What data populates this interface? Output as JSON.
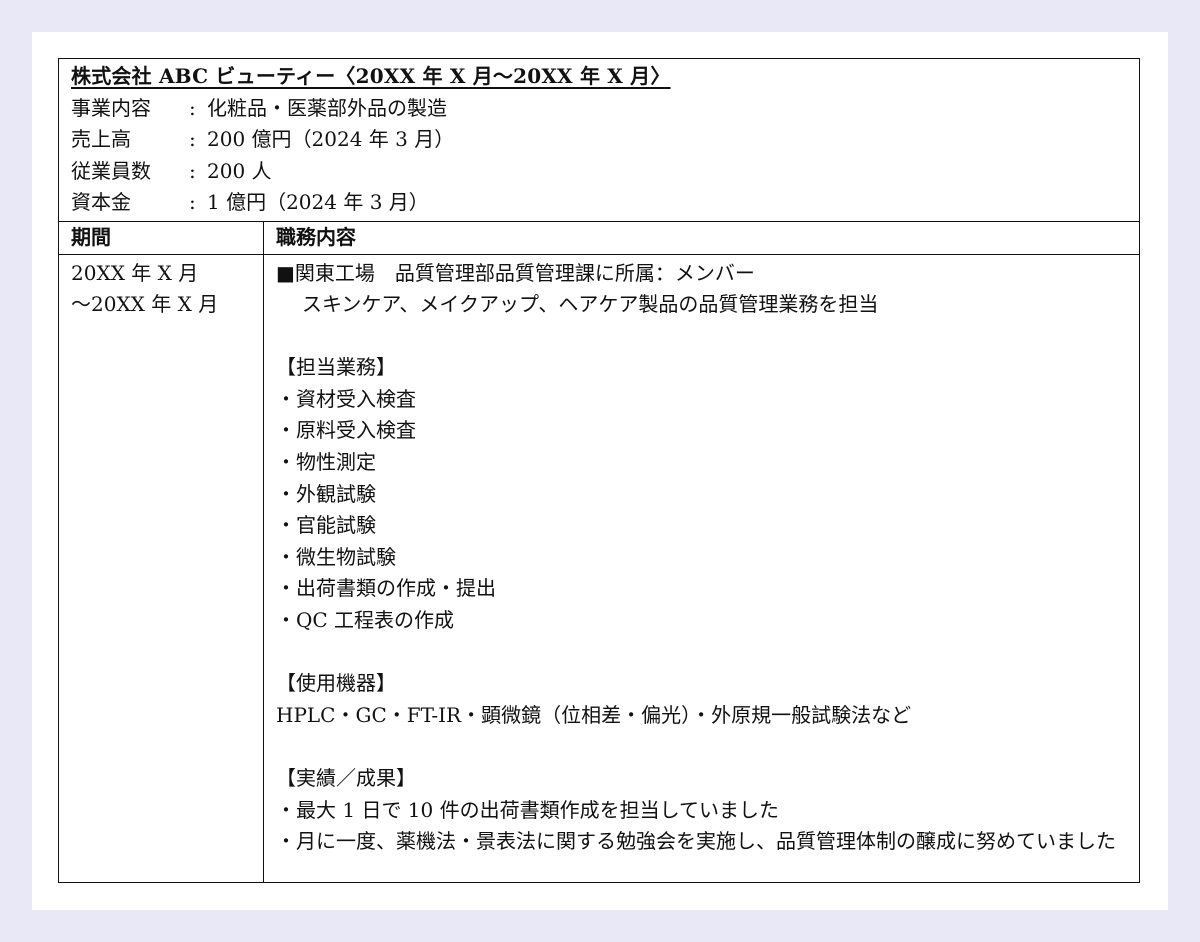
{
  "company": {
    "name": "株式会社 ABC ビューティー〈20XX 年 X 月〜20XX 年 X 月〉",
    "info": [
      {
        "label": "事業内容",
        "value": "化粧品・医薬部外品の製造"
      },
      {
        "label": "売上高",
        "value": "200 億円（2024 年 3 月）"
      },
      {
        "label": "従業員数",
        "value": "200 人"
      },
      {
        "label": "資本金",
        "value": "1 億円（2024 年 3 月）"
      }
    ],
    "separator": ":"
  },
  "table": {
    "header_period": "期間",
    "header_duties": "職務内容",
    "period_line1": "20XX 年 X 月",
    "period_line2": "〜20XX 年 X 月",
    "duty_title": "■関東工場　品質管理部品質管理課に所属：メンバー",
    "duty_summary": "スキンケア、メイクアップ、ヘアケア製品の品質管理業務を担当",
    "section_tasks": "【担当業務】",
    "tasks": [
      "・資材受入検査",
      "・原料受入検査",
      "・物性測定",
      "・外観試験",
      "・官能試験",
      "・微生物試験",
      "・出荷書類の作成・提出",
      "・QC 工程表の作成"
    ],
    "section_equipment": "【使用機器】",
    "equipment": "HPLC・GC・FT-IR・顕微鏡（位相差・偏光）・外原規一般試験法など",
    "section_results": "【実績／成果】",
    "result1": "・最大 1 日で 10 件の出荷書類作成を担当していました",
    "result2": "・月に一度、薬機法・景表法に関する勉強会を実施し、品質管理体制の醸成に努めていました"
  }
}
